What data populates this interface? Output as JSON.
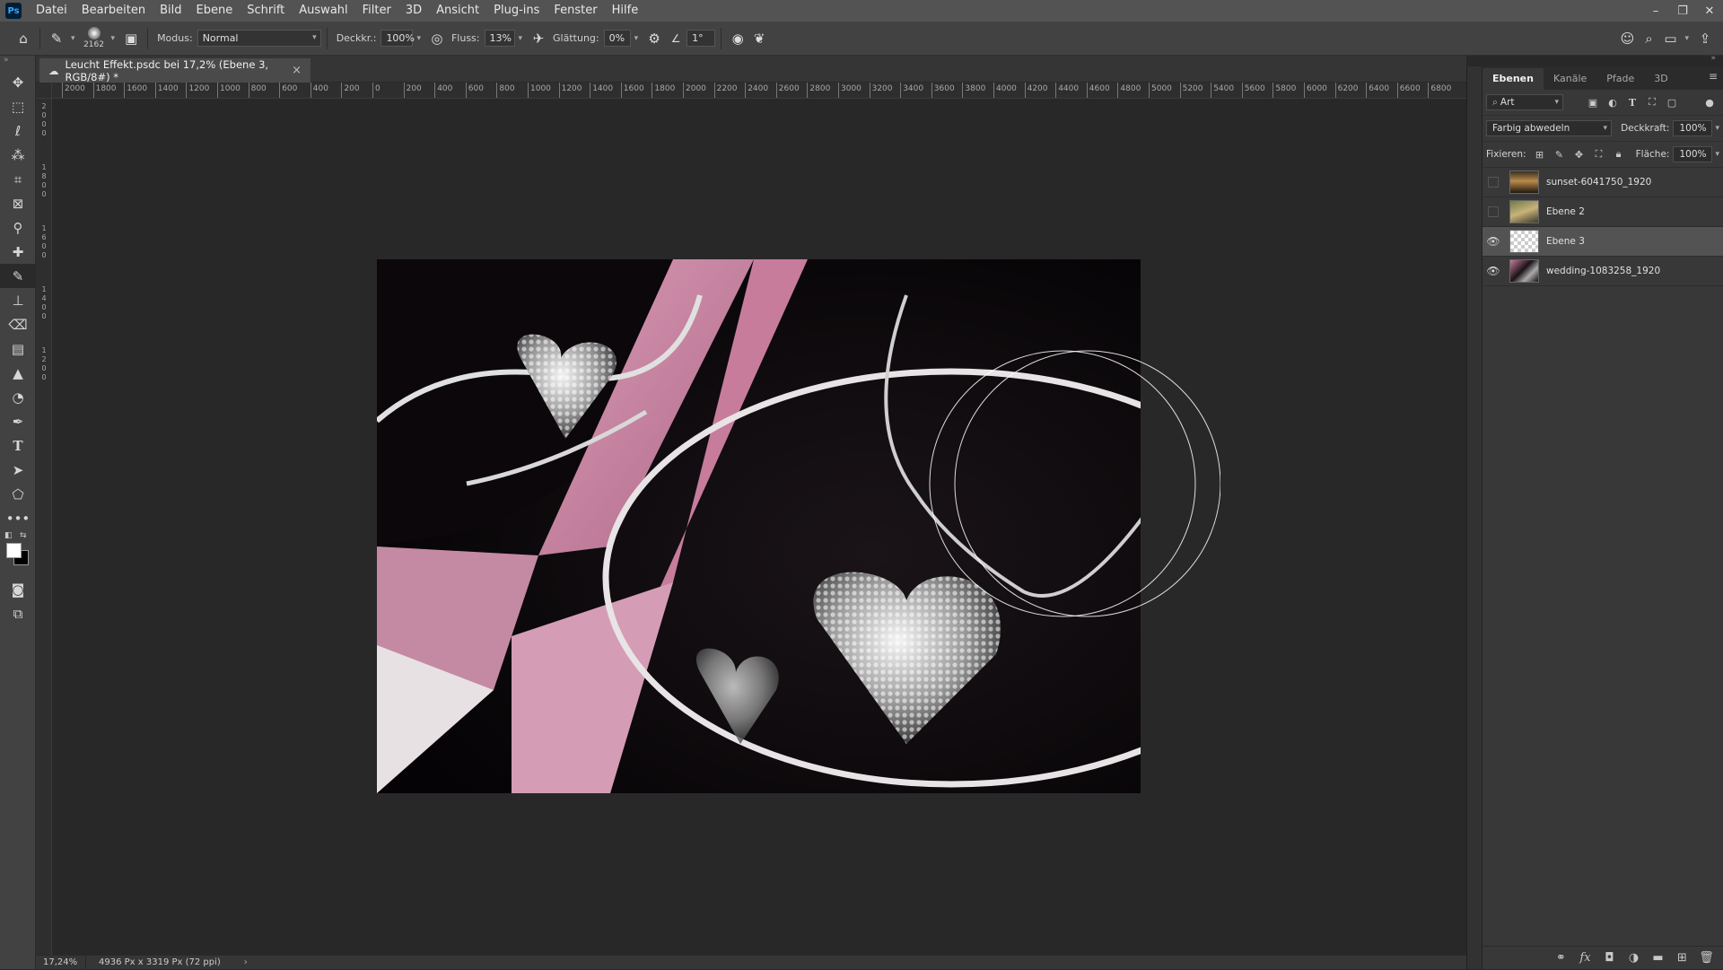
{
  "app": {
    "logo": "Ps"
  },
  "menu": [
    "Datei",
    "Bearbeiten",
    "Bild",
    "Ebene",
    "Schrift",
    "Auswahl",
    "Filter",
    "3D",
    "Ansicht",
    "Plug-ins",
    "Fenster",
    "Hilfe"
  ],
  "window_controls": {
    "minimize": "–",
    "restore": "❐",
    "close": "✕"
  },
  "options": {
    "brush_size": "2162",
    "mode_label": "Modus:",
    "mode_value": "Normal",
    "opacity_label": "Deckkr.:",
    "opacity_value": "100%",
    "flow_label": "Fluss:",
    "flow_value": "13%",
    "smoothing_label": "Glättung:",
    "smoothing_value": "0%",
    "angle_value": "1°"
  },
  "document": {
    "tab_title": "Leucht Effekt.psdc bei 17,2% (Ebene 3, RGB/8#) *",
    "close": "×"
  },
  "ruler": {
    "top": [
      "2000",
      "1800",
      "1600",
      "1400",
      "1200",
      "1000",
      "800",
      "600",
      "400",
      "200",
      "0",
      "200",
      "400",
      "600",
      "800",
      "1000",
      "1200",
      "1400",
      "1600",
      "1800",
      "2000",
      "2200",
      "2400",
      "2600",
      "2800",
      "3000",
      "3200",
      "3400",
      "3600",
      "3800",
      "4000",
      "4200",
      "4400",
      "4600",
      "4800",
      "5000",
      "5200",
      "5400",
      "5600",
      "5800",
      "6000",
      "6200",
      "6400",
      "6600",
      "6800"
    ],
    "left": [
      "2",
      "0",
      "0",
      "0",
      "1",
      "8",
      "0",
      "0",
      "1",
      "6",
      "0",
      "0",
      "1",
      "4",
      "0",
      "0",
      "1",
      "2",
      "0",
      "0"
    ]
  },
  "status": {
    "zoom": "17,24%",
    "doc_size": "4936 Px x 3319 Px (72 ppi)",
    "arrow": "›"
  },
  "panel": {
    "tabs": [
      "Ebenen",
      "Kanäle",
      "Pfade",
      "3D"
    ],
    "filter_kind": "Art",
    "blend_mode": "Farbig abwedeln",
    "opacity_label": "Deckkraft:",
    "opacity_value": "100%",
    "lock_label": "Fixieren:",
    "fill_label": "Fläche:",
    "fill_value": "100%",
    "layers": [
      {
        "name": "sunset-6041750_1920",
        "visible": false
      },
      {
        "name": "Ebene 2",
        "visible": false
      },
      {
        "name": "Ebene 3",
        "visible": true,
        "selected": true
      },
      {
        "name": "wedding-1083258_1920",
        "visible": true
      }
    ]
  },
  "colors": {
    "accent": "#31a8ff",
    "foreground": "#ffffff",
    "background": "#000000"
  }
}
